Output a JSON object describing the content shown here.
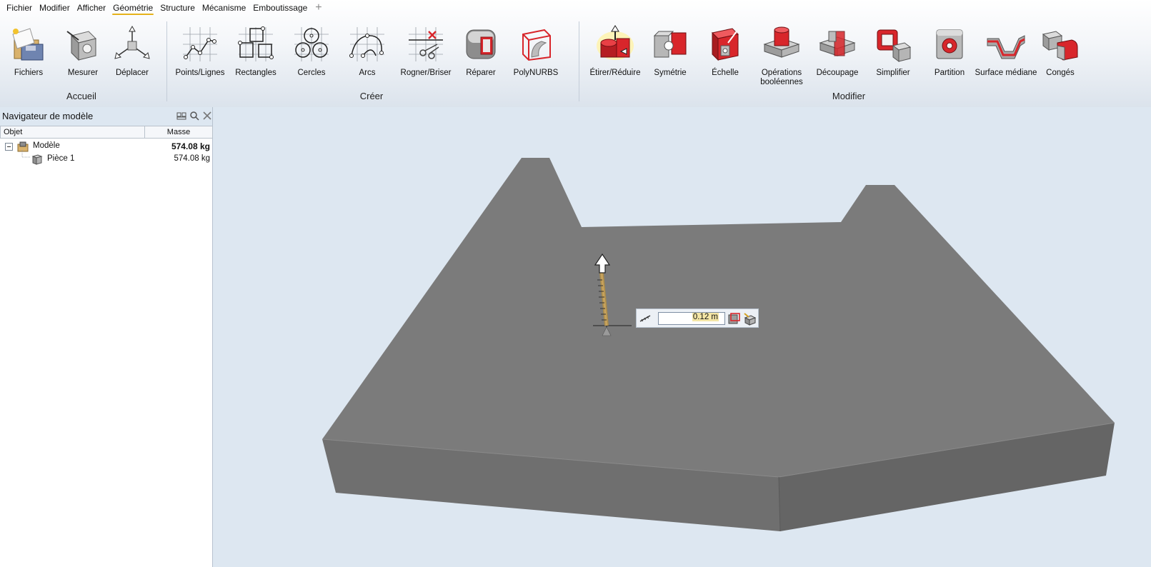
{
  "menu": {
    "tabs": [
      {
        "label": "Fichier"
      },
      {
        "label": "Modifier"
      },
      {
        "label": "Afficher"
      },
      {
        "label": "Géométrie",
        "active": true
      },
      {
        "label": "Structure"
      },
      {
        "label": "Mécanisme"
      },
      {
        "label": "Emboutissage"
      }
    ],
    "add_tab": "+"
  },
  "ribbon": {
    "groups": {
      "accueil": {
        "label": "Accueil",
        "tools": [
          {
            "label": "Fichiers",
            "icon": "files-icon"
          },
          {
            "label": "Mesurer",
            "icon": "measure-icon"
          },
          {
            "label": "Déplacer",
            "icon": "move-icon"
          }
        ]
      },
      "creer": {
        "label": "Créer",
        "tools": [
          {
            "label": "Points/Lignes",
            "icon": "points-lines-icon"
          },
          {
            "label": "Rectangles",
            "icon": "rectangles-icon"
          },
          {
            "label": "Cercles",
            "icon": "circles-icon"
          },
          {
            "label": "Arcs",
            "icon": "arcs-icon"
          },
          {
            "label": "Rogner/Briser",
            "icon": "trim-break-icon"
          },
          {
            "label": "Réparer",
            "icon": "repair-icon"
          },
          {
            "label": "PolyNURBS",
            "icon": "polynurbs-icon"
          }
        ]
      },
      "modifier": {
        "label": "Modifier",
        "tools": [
          {
            "label": "Étirer/Réduire",
            "icon": "push-pull-icon",
            "active": true
          },
          {
            "label": "Symétrie",
            "icon": "symmetry-icon"
          },
          {
            "label": "Échelle",
            "icon": "scale-icon"
          },
          {
            "label": "Opérations booléennes",
            "icon": "boolean-icon"
          },
          {
            "label": "Découpage",
            "icon": "split-icon"
          },
          {
            "label": "Simplifier",
            "icon": "simplify-icon"
          },
          {
            "label": "Partition",
            "icon": "partition-icon"
          },
          {
            "label": "Surface médiane",
            "icon": "midsurface-icon"
          },
          {
            "label": "Congés",
            "icon": "fillets-icon"
          }
        ]
      }
    }
  },
  "navigator": {
    "title": "Navigateur de modèle",
    "columns": {
      "object": "Objet",
      "mass": "Masse"
    },
    "rows": [
      {
        "name": "Modèle",
        "mass": "574.08 kg",
        "bold": true,
        "icon": "model-icon"
      },
      {
        "name": "Pièce 1",
        "mass": "574.08 kg",
        "bold": false,
        "icon": "part-icon"
      }
    ]
  },
  "viewport": {
    "distance_value": "0.12 m"
  },
  "colors": {
    "accent_tab_underline": "#e5b21a",
    "tool_red": "#d8262b",
    "part_top": "#7a7a7a",
    "part_front": "#6c6c6c",
    "part_right": "#646464",
    "viewport_bg": "#dde7f1"
  }
}
